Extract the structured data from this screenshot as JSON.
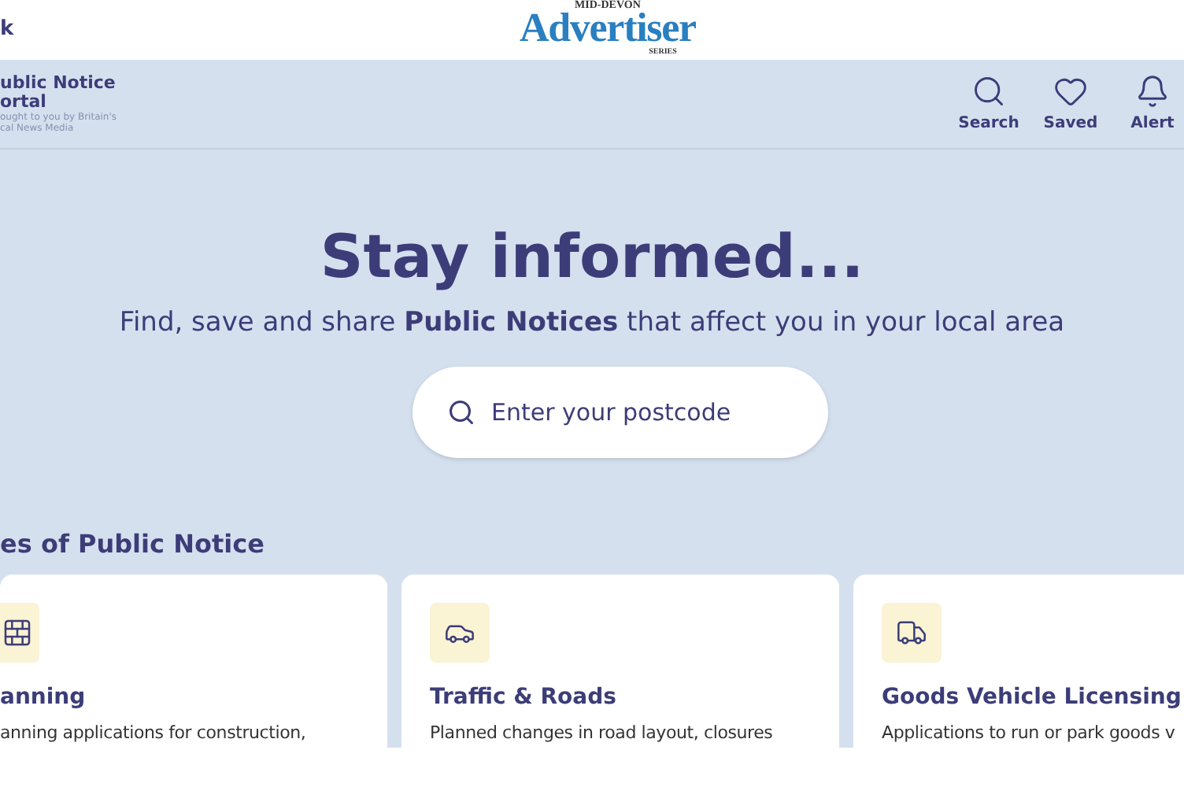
{
  "top_bar": {
    "back_link": "k",
    "logo": {
      "top": "MID-DEVON",
      "main": "Advertiser",
      "bottom": "SERIES"
    }
  },
  "header": {
    "brand": {
      "title_lines": [
        "ublic Notice",
        "ortal"
      ],
      "tagline_lines": [
        "ought to you by Britain's",
        "cal News Media"
      ]
    },
    "nav": [
      {
        "kind": "search",
        "label": "Search"
      },
      {
        "kind": "saved",
        "label": "Saved"
      },
      {
        "kind": "alerts",
        "label": "Alert"
      }
    ]
  },
  "hero": {
    "title": "Stay informed...",
    "subtitle": "Find, save and share **Public Notices** that affect you in your local area",
    "search": {
      "placeholder": "Enter your postcode"
    }
  },
  "section": {
    "heading": "es of Public Notice",
    "cards": [
      {
        "kind": "planning",
        "title": "anning",
        "description": "anning applications for construction,"
      },
      {
        "kind": "traffic",
        "title": "Traffic & Roads",
        "description": "Planned changes in road layout, closures"
      },
      {
        "kind": "goods",
        "title": "Goods Vehicle Licensing",
        "description": "Applications to run or park goods v"
      }
    ]
  }
}
